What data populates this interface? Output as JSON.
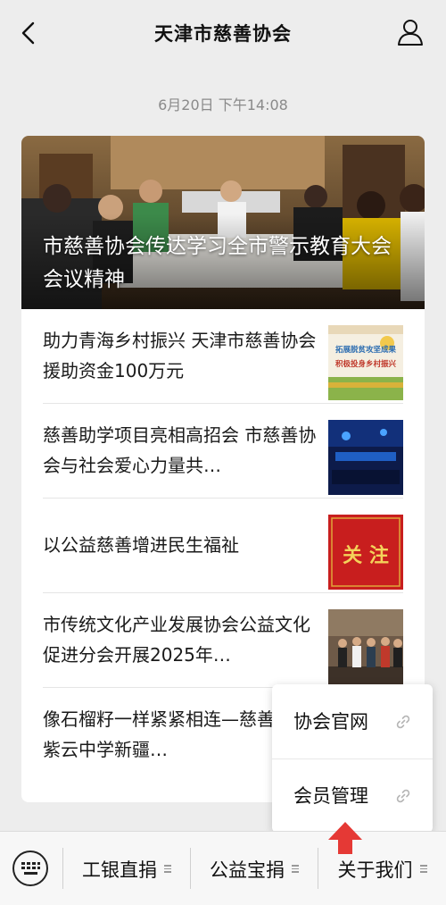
{
  "header": {
    "title": "天津市慈善协会",
    "back_icon": "chevron-left-icon",
    "profile_icon": "user-icon"
  },
  "timestamp": "6月20日 下午14:08",
  "hero": {
    "title": "市慈善协会传达学习全市警示教育大会会议精神"
  },
  "articles": [
    {
      "title": "助力青海乡村振兴 天津市慈善协会援助资金100万元"
    },
    {
      "title": "慈善助学项目亮相高招会 市慈善协会与社会爱心力量共…"
    },
    {
      "title": "以公益慈善增进民生福祉"
    },
    {
      "title": "市传统文化产业发展协会公益文化促进分会开展2025年…"
    },
    {
      "title": "像石榴籽一样紧紧相连—慈善走进紫云中学新疆…"
    }
  ],
  "thumb_texts": {
    "t1_line1": "拓展脱贫攻坚成果",
    "t1_line2": "积极投身乡村振兴",
    "t3_text": "关 注"
  },
  "menu": {
    "items": [
      {
        "label": "工银直捐"
      },
      {
        "label": "公益宝捐"
      },
      {
        "label": "关于我们"
      }
    ],
    "submenu": [
      {
        "label": "协会官网"
      },
      {
        "label": "会员管理"
      }
    ]
  },
  "colors": {
    "background": "#ededed",
    "card": "#ffffff",
    "arrow": "#e53935",
    "thumb_red": "#c81e1e"
  }
}
